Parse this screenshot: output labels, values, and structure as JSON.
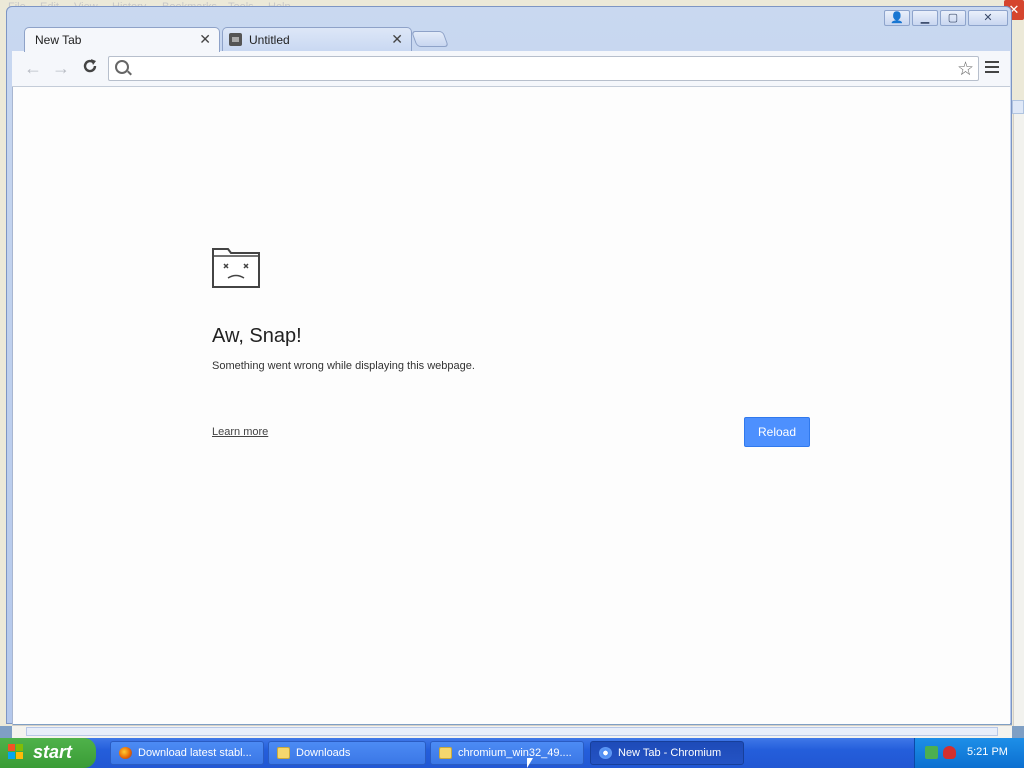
{
  "background_window": {
    "menu": [
      "File",
      "Edit",
      "View",
      "History",
      "Bookmarks",
      "Tools",
      "Help"
    ],
    "close_glyph": "✕"
  },
  "window": {
    "controls": {
      "profile": "👤",
      "minimize": "▁",
      "maximize": "▢",
      "close": "✕"
    }
  },
  "tabs": [
    {
      "label": "New Tab",
      "close": "✕"
    },
    {
      "label": "Untitled",
      "close": "✕"
    }
  ],
  "toolbar": {
    "back": "←",
    "forward": "→",
    "reload": "C",
    "omnibox_value": "",
    "omnibox_placeholder": "",
    "bookmark_star": "☆"
  },
  "error_page": {
    "icon": "sad-tab-icon",
    "title": "Aw, Snap!",
    "message": "Something went wrong while displaying this webpage.",
    "learn_more": "Learn more",
    "reload_button": "Reload"
  },
  "taskbar": {
    "start_label": "start",
    "tasks": [
      {
        "label": "Download latest stabl...",
        "icon": "firefox-icon"
      },
      {
        "label": "Downloads",
        "icon": "folder-icon"
      },
      {
        "label": "chromium_win32_49....",
        "icon": "folder-icon"
      },
      {
        "label": "New Tab - Chromium",
        "icon": "chromium-icon"
      }
    ],
    "clock": "5:21 PM"
  },
  "colors": {
    "reload_button_bg": "#4d90fe",
    "taskbar_blue": "#245edb",
    "start_green": "#3a9c36",
    "frame_blue": "#b4c8ec"
  }
}
